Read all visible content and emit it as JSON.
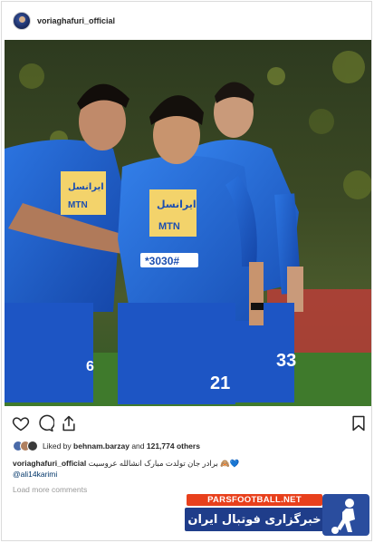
{
  "post": {
    "username": "voriaghafuri_official",
    "likes": {
      "prefix": "Liked by",
      "user": "behnam.barzay",
      "and_text": "and",
      "count": "121,774 others"
    },
    "caption": {
      "username": "voriaghafuri_official",
      "text": "برادر جان تولدت مبارک انشالله عروسیت 🙈💙",
      "mention": "@ali14karimi"
    },
    "load_more": "Load more comments"
  },
  "photo": {
    "shirt_texts": [
      "ایرانسل",
      "MTN"
    ],
    "jersey_numbers": [
      "21",
      "33",
      "6"
    ],
    "sponsor_number": "*3030#"
  },
  "icons": [
    "heart-icon",
    "comment-icon",
    "share-icon",
    "bookmark-icon"
  ],
  "banner": {
    "site": "PARSFOOTBALL.NET",
    "tagline": "خبرگزاری فوتبال ایران"
  },
  "colors": {
    "jersey_blue": "#1f5fd0",
    "banner_orange": "#e8401c",
    "banner_blue": "#1f3d8a"
  }
}
